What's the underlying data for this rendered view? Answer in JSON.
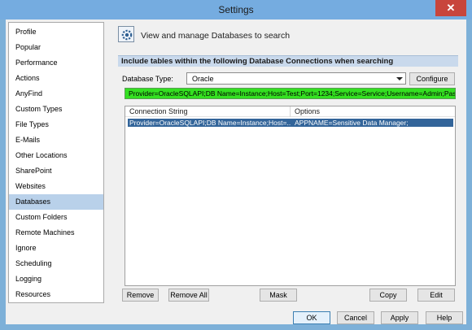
{
  "window": {
    "title": "Settings",
    "close_symbol": "✕"
  },
  "sidebar": {
    "items": [
      {
        "label": "Profile"
      },
      {
        "label": "Popular"
      },
      {
        "label": "Performance"
      },
      {
        "label": "Actions"
      },
      {
        "label": "AnyFind"
      },
      {
        "label": "Custom Types"
      },
      {
        "label": "File Types"
      },
      {
        "label": "E-Mails"
      },
      {
        "label": "Other Locations"
      },
      {
        "label": "SharePoint"
      },
      {
        "label": "Websites"
      },
      {
        "label": "Databases"
      },
      {
        "label": "Custom Folders"
      },
      {
        "label": "Remote Machines"
      },
      {
        "label": "Ignore"
      },
      {
        "label": "Scheduling"
      },
      {
        "label": "Logging"
      },
      {
        "label": "Resources"
      }
    ],
    "selected": "Databases"
  },
  "main": {
    "header_icon": "settings-gear-icon",
    "header_text": "View and manage Databases to search",
    "section_title": "Include tables within the following Database Connections when searching",
    "db_type_label": "Database Type:",
    "db_type_value": "Oracle",
    "configure_label": "Configure",
    "connection_input": "Provider=OracleSQLAPI;DB Name=Instance;Host=Test;Port=1234;Service=Service;Username=Admin;Passw",
    "table": {
      "columns": [
        "Connection String",
        "Options"
      ],
      "rows": [
        {
          "connection": "Provider=OracleSQLAPI;DB Name=Instance;Host=...",
          "options": "APPNAME=Sensitive Data Manager;"
        }
      ]
    },
    "buttons": {
      "remove": "Remove",
      "remove_all": "Remove All",
      "mask": "Mask",
      "copy": "Copy",
      "edit": "Edit"
    }
  },
  "footer": {
    "ok": "OK",
    "cancel": "Cancel",
    "apply": "Apply",
    "help": "Help"
  },
  "colors": {
    "highlight_green": "#34e021",
    "selected_row": "#33659a",
    "nav_selected": "#b9d1ea"
  }
}
